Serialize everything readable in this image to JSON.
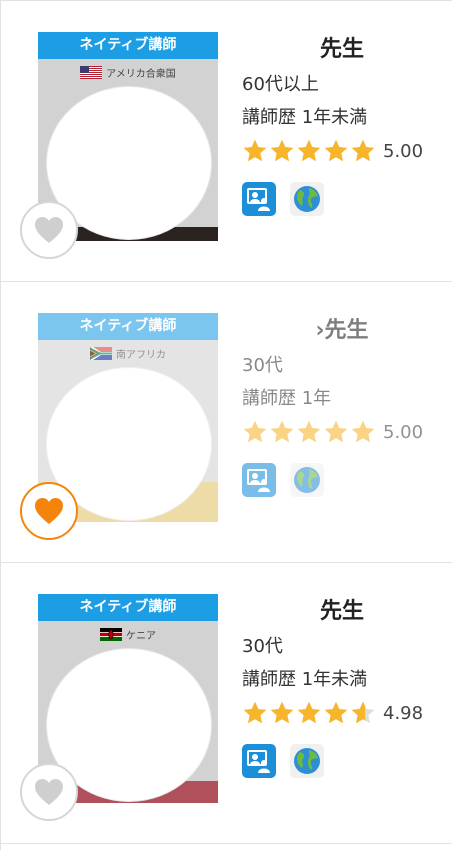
{
  "colors": {
    "native_bar": "#1d9ee4",
    "star": "#f7b52c",
    "favorite_active": "#f5840c",
    "favorite_inactive": "#cfcfcf",
    "lesson_icon_bg": "#1b8fd8"
  },
  "teachers": [
    {
      "badge": "ネイティブ講師",
      "country": "アメリカ合衆国",
      "flag": "us-flag",
      "name": "先生",
      "age": "60代以上",
      "experience": "講師歴  1年未満",
      "rating": 5.0,
      "rating_text": "5.00",
      "favorited": false,
      "icons": [
        "video-lesson-icon",
        "globe-icon"
      ]
    },
    {
      "badge": "ネイティブ講師",
      "country": "南アフリカ",
      "flag": "south-africa-flag",
      "name": "›先生",
      "age": "30代",
      "experience": "講師歴  1年",
      "rating": 5.0,
      "rating_text": "5.00",
      "favorited": true,
      "icons": [
        "video-lesson-icon",
        "globe-icon"
      ]
    },
    {
      "badge": "ネイティブ講師",
      "country": "ケニア",
      "flag": "kenya-flag",
      "name": "先生",
      "age": "30代",
      "experience": "講師歴  1年未満",
      "rating": 4.98,
      "rating_text": "4.98",
      "favorited": false,
      "icons": [
        "video-lesson-icon",
        "globe-icon"
      ]
    }
  ]
}
